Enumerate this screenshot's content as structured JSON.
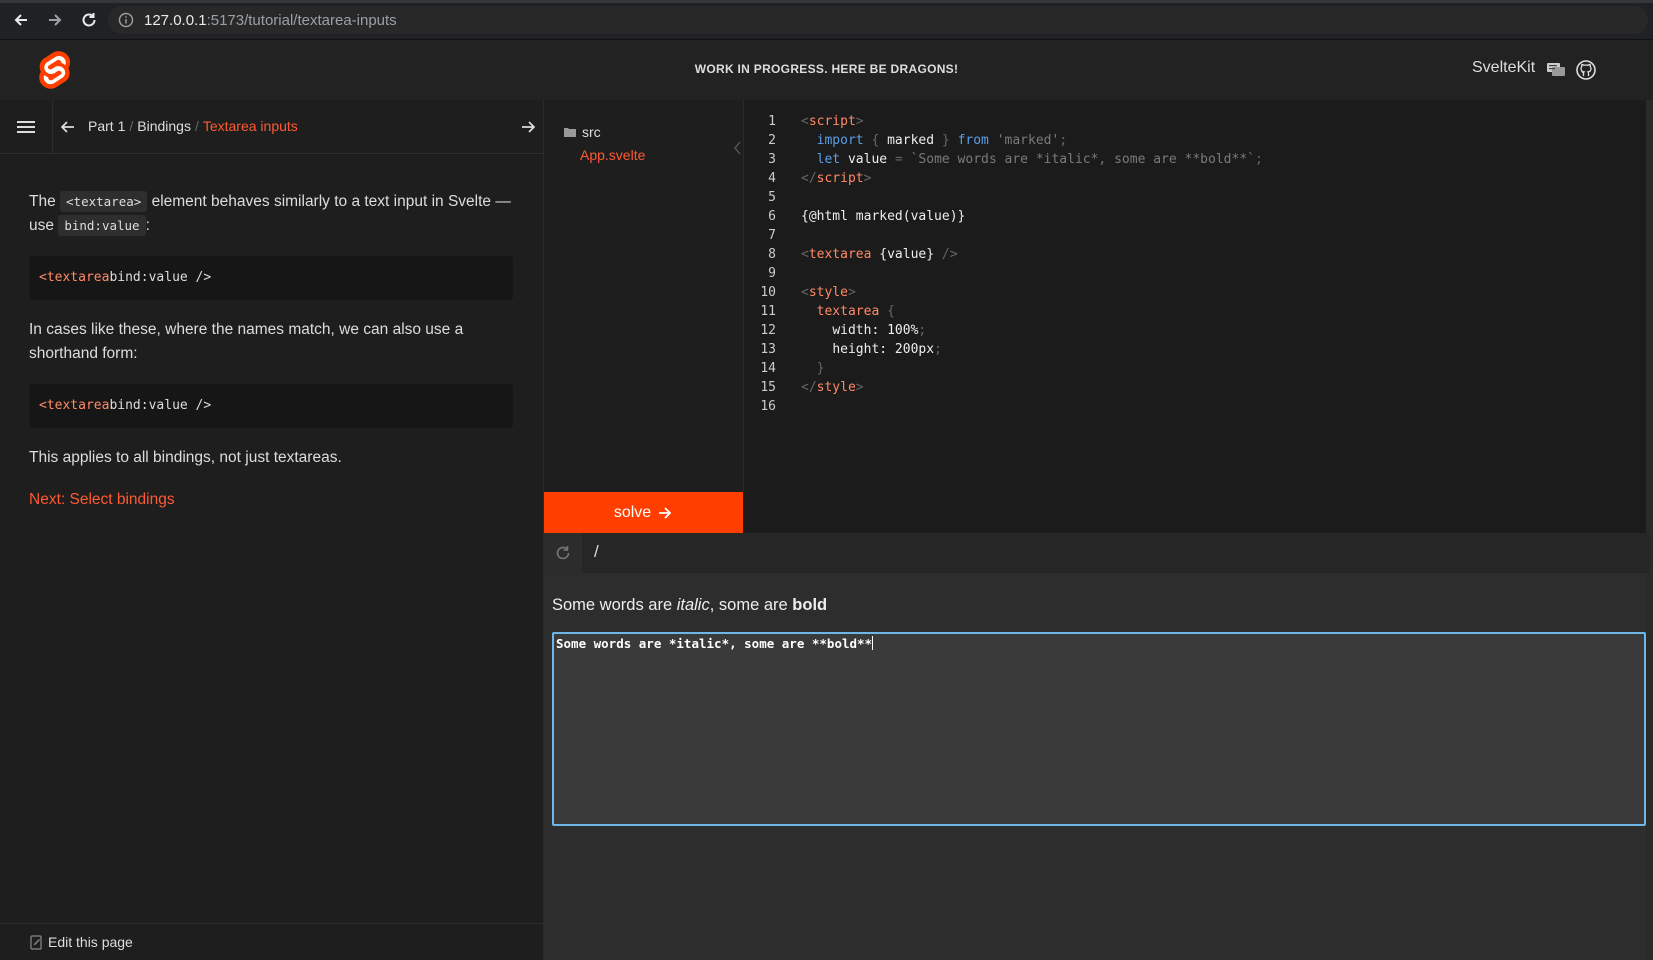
{
  "browser": {
    "url_host": "127.0.0.1",
    "url_rest": ":5173/tutorial/textarea-inputs"
  },
  "header": {
    "banner": "WORK IN PROGRESS. HERE BE DRAGONS!",
    "brand": "SvelteKit",
    "icons": [
      "svelte-logo-icon",
      "chat-icon",
      "github-icon"
    ],
    "accent": "#ff3e00"
  },
  "breadcrumb": {
    "part": "Part 1",
    "section": "Bindings",
    "current": "Textarea inputs"
  },
  "tutorial": {
    "p1_before": "The ",
    "p1_code1": "<textarea>",
    "p1_middle": " element behaves similarly to a text input in Svelte — use ",
    "p1_code2": "bind:value",
    "p1_after": ":",
    "code1_tag": "<textarea",
    "code1_rest": " bind:value />",
    "p2": "In cases like these, where the names match, we can also use a shorthand form:",
    "code2_tag": "<textarea",
    "code2_rest": " bind:value />",
    "p3": "This applies to all bindings, not just textareas.",
    "next": "Next: Select bindings",
    "edit": "Edit this page"
  },
  "file_tree": {
    "folder": "src",
    "file": "App.svelte",
    "solve": "solve"
  },
  "editor": {
    "line_numbers": [
      "1",
      "2",
      "3",
      "4",
      "5",
      "6",
      "7",
      "8",
      "9",
      "10",
      "11",
      "12",
      "13",
      "14",
      "15",
      "16"
    ],
    "l1": "script",
    "l2_kw": "import",
    "l2_name": "marked",
    "l2_from": "from",
    "l2_str": "'marked'",
    "l3_kw": "let",
    "l3_name": "value",
    "l3_str": "`Some words are *italic*, some are **bold**`",
    "l4": "script",
    "l6": "{@html marked(value)}",
    "l8_tag": "textarea",
    "l8_attr": "{value}",
    "l10": "style",
    "l11": "textarea",
    "l12": "width: 100%",
    "l13": "height: 200px",
    "l15": "style"
  },
  "preview": {
    "path": "/",
    "rendered_a": "Some words are ",
    "rendered_italic": "italic",
    "rendered_b": ", some are ",
    "rendered_bold": "bold",
    "textarea_value": "Some words are *italic*, some are **bold**"
  }
}
